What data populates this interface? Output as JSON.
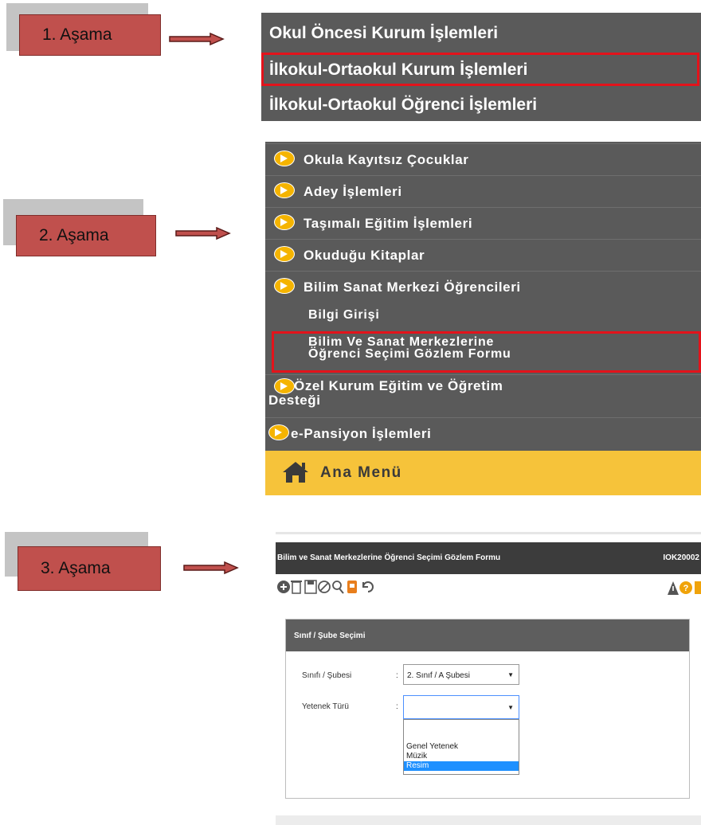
{
  "stages": [
    {
      "label": "1. Aşama"
    },
    {
      "label": "2. Aşama"
    },
    {
      "label": "3. Aşama"
    }
  ],
  "panel1": {
    "items": [
      {
        "label": "Okul Öncesi Kurum İşlemleri"
      },
      {
        "label": "İlkokul-Ortaokul Kurum İşlemleri"
      },
      {
        "label": "İlkokul-Ortaokul Öğrenci İşlemleri"
      }
    ]
  },
  "panel2": {
    "items": [
      {
        "label": "Okula Kayıtsız Çocuklar"
      },
      {
        "label": "Adey İşlemleri"
      },
      {
        "label": "Taşımalı Eğitim İşlemleri"
      },
      {
        "label": "Okuduğu Kitaplar"
      },
      {
        "label": "Bilim Sanat Merkezi Öğrencileri"
      }
    ],
    "subitems": [
      {
        "label": "Bilgi Girişi"
      },
      {
        "line1": "Bilim Ve Sanat Merkezlerine",
        "line2": "Öğrenci Seçimi Gözlem Formu"
      }
    ],
    "items2": [
      {
        "line1": "Özel Kurum Eğitim ve Öğretim",
        "line2": "Desteği"
      },
      {
        "label": "e-Pansiyon İşlemleri"
      }
    ],
    "ana_menu": "Ana Menü"
  },
  "panel3": {
    "title": "Bilim ve Sanat Merkezlerine Öğrenci Seçimi Gözlem Formu",
    "code": "IOK20002",
    "card_title": "Sınıf / Şube Seçimi",
    "fields": [
      {
        "label": "Sınıfı / Şubesi",
        "sep": ":",
        "value": "2. Sınıf / A Şubesi"
      },
      {
        "label": "Yetenek Türü",
        "sep": ":",
        "value": ""
      }
    ],
    "dropdown_options": [
      "",
      "Genel Yetenek",
      "Müzik",
      "Resim"
    ],
    "highlighted_option": "Resim"
  },
  "colors": {
    "stage_fill": "#c0504d",
    "menu_bg": "#5a5a5a",
    "highlight_frame": "#e3131b",
    "ana_menu_bg": "#f6c33a",
    "bullet": "#f5b400",
    "selected_option": "#1e90ff"
  }
}
